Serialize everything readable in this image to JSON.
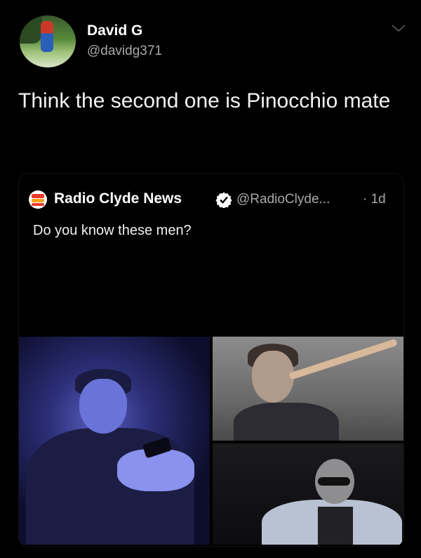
{
  "tweet": {
    "author_name": "David G",
    "author_handle": "@davidg371",
    "text": "Think the second one is Pinocchio mate"
  },
  "quoted_tweet": {
    "author_name": "Radio Clyde News",
    "author_handle": "@RadioClyde...",
    "time": "· 1d",
    "text": "Do you know these men?"
  },
  "icons": {
    "menu": "chevron-down-icon",
    "verified": "verified-badge-icon",
    "logo": "radio-clyde-logo"
  },
  "colors": {
    "background": "#000000",
    "primary_text": "#ffffff",
    "secondary_text": "#a8a8a8",
    "verified": "#ffffff"
  }
}
